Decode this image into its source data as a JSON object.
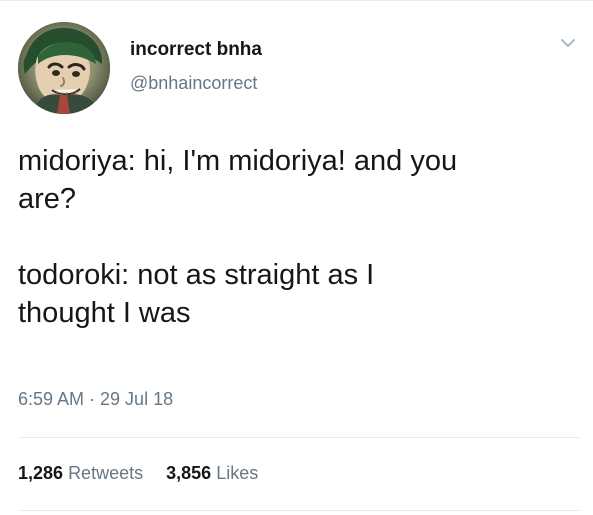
{
  "user": {
    "display_name": "incorrect bnha",
    "handle": "@bnhaincorrect",
    "avatar_icon": "profile-avatar"
  },
  "tweet": {
    "paragraph_1": {
      "line_1": "midoriya: hi, I'm midoriya! and you",
      "line_2": "are?"
    },
    "paragraph_2": {
      "line_1": "todoroki: not as straight as I",
      "line_2": "thought I was"
    },
    "timestamp": "6:59 AM · 29 Jul 18"
  },
  "stats": {
    "retweets_count": "1,286",
    "retweets_label": "Retweets",
    "likes_count": "3,856",
    "likes_label": "Likes"
  },
  "icons": {
    "more_options": "chevron-down-icon"
  },
  "colors": {
    "primary_text": "#14171a",
    "secondary_text": "#657786",
    "divider": "#e6ecf0",
    "background": "#ffffff"
  }
}
